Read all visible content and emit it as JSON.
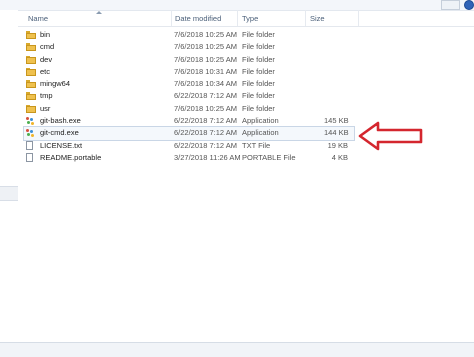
{
  "columns": {
    "name": "Name",
    "date_modified": "Date modified",
    "type": "Type",
    "size": "Size"
  },
  "files": [
    {
      "icon": "folder-icon",
      "name": "bin",
      "date": "7/6/2018 10:25 AM",
      "type": "File folder",
      "size": ""
    },
    {
      "icon": "folder-icon",
      "name": "cmd",
      "date": "7/6/2018 10:25 AM",
      "type": "File folder",
      "size": ""
    },
    {
      "icon": "folder-icon",
      "name": "dev",
      "date": "7/6/2018 10:25 AM",
      "type": "File folder",
      "size": ""
    },
    {
      "icon": "folder-icon",
      "name": "etc",
      "date": "7/6/2018 10:31 AM",
      "type": "File folder",
      "size": ""
    },
    {
      "icon": "folder-icon",
      "name": "mingw64",
      "date": "7/6/2018 10:34 AM",
      "type": "File folder",
      "size": ""
    },
    {
      "icon": "folder-icon",
      "name": "tmp",
      "date": "6/22/2018 7:12 AM",
      "type": "File folder",
      "size": ""
    },
    {
      "icon": "folder-icon",
      "name": "usr",
      "date": "7/6/2018 10:25 AM",
      "type": "File folder",
      "size": ""
    },
    {
      "icon": "git-app-icon",
      "name": "git-bash.exe",
      "date": "6/22/2018 7:12 AM",
      "type": "Application",
      "size": "145 KB"
    },
    {
      "icon": "git-app-icon",
      "name": "git-cmd.exe",
      "date": "6/22/2018 7:12 AM",
      "type": "Application",
      "size": "144 KB"
    },
    {
      "icon": "document-icon",
      "name": "LICENSE.txt",
      "date": "6/22/2018 7:12 AM",
      "type": "TXT File",
      "size": "19 KB"
    },
    {
      "icon": "document-icon",
      "name": "README.portable",
      "date": "3/27/2018 11:26 AM",
      "type": "PORTABLE File",
      "size": "4 KB"
    }
  ],
  "selected_index": 8,
  "annotation": {
    "icon": "red-arrow-icon",
    "color": "#d4262e"
  }
}
